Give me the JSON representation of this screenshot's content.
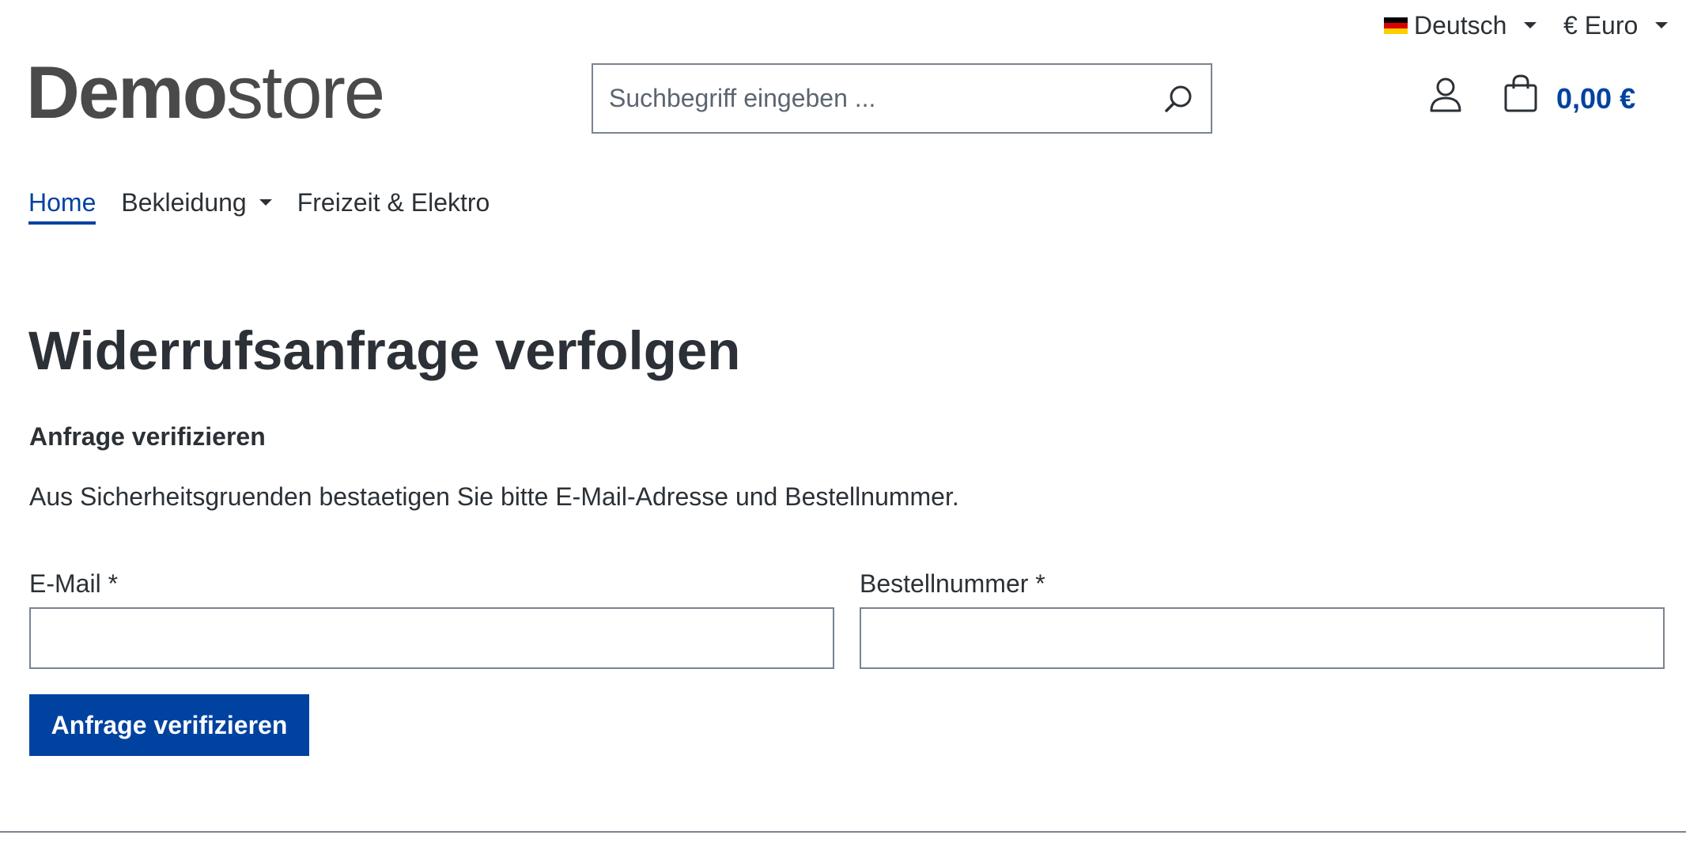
{
  "topbar": {
    "language": {
      "label": "Deutsch",
      "flag_colors": [
        "#000000",
        "#dd0000",
        "#ffce00"
      ]
    },
    "currency": {
      "label": "€ Euro"
    }
  },
  "header": {
    "logo_bold": "Demo",
    "logo_light": "store",
    "search": {
      "placeholder": "Suchbegriff eingeben ...",
      "value": "",
      "icon": "search-icon"
    },
    "account_icon": "user-icon",
    "cart_icon": "shopping-bag-icon",
    "cart_total": "0,00 €"
  },
  "nav": {
    "items": [
      {
        "label": "Home",
        "active": true,
        "has_dropdown": false
      },
      {
        "label": "Bekleidung",
        "active": false,
        "has_dropdown": true
      },
      {
        "label": "Freizeit & Elektro",
        "active": false,
        "has_dropdown": false
      }
    ]
  },
  "main": {
    "title": "Widerrufsanfrage verfolgen",
    "subtitle": "Anfrage verifizieren",
    "description": "Aus Sicherheitsgruenden bestaetigen Sie bitte E-Mail-Adresse und Bestellnummer.",
    "email_label": "E-Mail *",
    "email_value": "",
    "order_label": "Bestellnummer *",
    "order_value": "",
    "submit_label": "Anfrage verifizieren"
  },
  "colors": {
    "primary": "#0042a0",
    "text": "#2b3136",
    "border": "#798490"
  }
}
